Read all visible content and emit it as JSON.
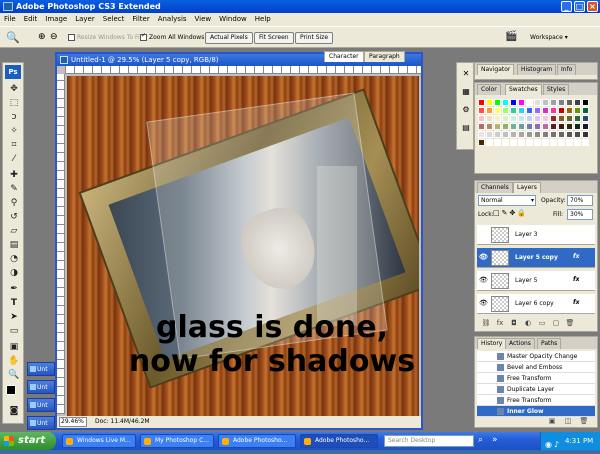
{
  "app": {
    "title": "Adobe Photoshop CS3 Extended"
  },
  "menu": [
    "File",
    "Edit",
    "Image",
    "Layer",
    "Select",
    "Filter",
    "Analysis",
    "View",
    "Window",
    "Help"
  ],
  "options": {
    "resize_windows": "Resize Windows To Fit",
    "zoom_all": "Zoom All Windows",
    "actual_pixels": "Actual Pixels",
    "fit_screen": "Fit Screen",
    "print_size": "Print Size",
    "workspace": "Workspace"
  },
  "document": {
    "title": "Untitled-1 @ 29.5% (Layer 5 copy, RGB/8)",
    "zoom": "29.46%",
    "docsize": "Doc: 11.4M/46.2M",
    "overlay_line1": "glass is done,",
    "overlay_line2": "now for shadows"
  },
  "char_tabs": [
    "Character",
    "Paragraph"
  ],
  "nav_tabs": [
    "Navigator",
    "Histogram",
    "Info"
  ],
  "swatch_tabs": [
    "Color",
    "Swatches",
    "Styles"
  ],
  "swatch_colors": [
    "#ff0000",
    "#ffff00",
    "#00ff00",
    "#00ffff",
    "#0000ff",
    "#ff00ff",
    "#ffffff",
    "#e0e0e0",
    "#c0c0c0",
    "#a0a0a0",
    "#808080",
    "#606060",
    "#404040",
    "#000000",
    "#ff4d4d",
    "#ff9933",
    "#ffff66",
    "#99ff66",
    "#33cc99",
    "#33ccff",
    "#3366ff",
    "#9966ff",
    "#cc33cc",
    "#ff3399",
    "#cc0000",
    "#996600",
    "#669900",
    "#006633"
  ],
  "layers": {
    "tabs": [
      "Channels",
      "Layers"
    ],
    "blend_mode": "Normal",
    "opacity_label": "Opacity:",
    "opacity": "70%",
    "lock_label": "Lock:",
    "fill_label": "Fill:",
    "fill": "30%",
    "rows": [
      {
        "name": "Layer 3",
        "fx": "",
        "selected": false,
        "visible": false
      },
      {
        "name": "Layer 5 copy",
        "fx": "fx",
        "selected": true,
        "visible": true
      },
      {
        "name": "Layer 5",
        "fx": "fx",
        "selected": false,
        "visible": true
      },
      {
        "name": "Layer 6 copy",
        "fx": "fx",
        "selected": false,
        "visible": true
      }
    ]
  },
  "history": {
    "tabs": [
      "History",
      "Actions",
      "Paths"
    ],
    "rows": [
      {
        "name": "Master Opacity Change",
        "selected": false
      },
      {
        "name": "Bevel and Emboss",
        "selected": false
      },
      {
        "name": "Free Transform",
        "selected": false
      },
      {
        "name": "Duplicate Layer",
        "selected": false
      },
      {
        "name": "Free Transform",
        "selected": false
      },
      {
        "name": "Inner Glow",
        "selected": true
      }
    ]
  },
  "minimized_docs": [
    "Unt",
    "Unt",
    "Unt",
    "Unt"
  ],
  "taskbar": {
    "start": "start",
    "tasks": [
      "Windows Live M...",
      "My Photoshop C...",
      "Adobe Photosho...",
      "Adobe Photosho..."
    ],
    "search_placeholder": "Search Desktop",
    "clock": "4:31 PM"
  }
}
